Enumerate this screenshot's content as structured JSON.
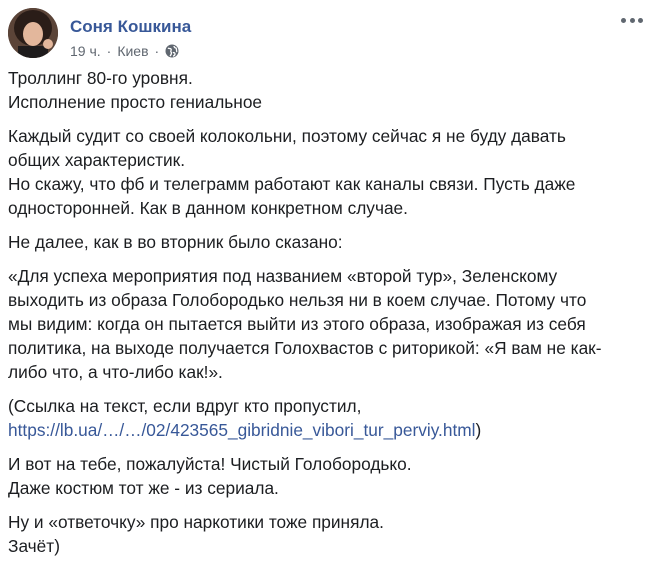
{
  "author": {
    "name": "Соня Кошкина",
    "time": "19 ч.",
    "separator": "·",
    "location": "Киев"
  },
  "icons": {
    "privacy": "globe-icon",
    "more": "more-options-icon"
  },
  "colors": {
    "link": "#385898",
    "meta": "#606770",
    "text": "#1c1e21"
  },
  "post": {
    "p1": "Троллинг 80-го уровня.\nИсполнение просто гениальное",
    "p2": "Каждый судит со своей колокольни, поэтому сейчас я не буду давать\nобщих характеристик.\nНо скажу, что фб и телеграмм работают как каналы связи. Пусть даже\nодносторонней. Как в данном конкретном случае.",
    "p3": "Не далее, как в во вторник было сказано:",
    "p4": "«Для успеха мероприятия под названием «второй тур», Зеленскому\nвыходить из образа Голобородько нельзя ни в коем случае. Потому что\nмы видим: когда он пытается выйти из этого образа, изображая из себя\nполитика, на выходе получается Голохвастов с риторикой: «Я вам не как-\nлибо что, а что-либо как!».",
    "p5_text": "(Ссылка на текст, если вдруг кто пропустил,",
    "p5_link": "https://lb.ua/…/…/02/423565_gibridnie_vibori_tur_perviy.html",
    "p5_close": ")",
    "p6": "И вот на тебе, пожалуйста! Чистый Голобородько.\nДаже костюм тот же - из сериала.",
    "p7": "Ну и «ответочку» про наркотики тоже приняла.\nЗачёт)"
  }
}
